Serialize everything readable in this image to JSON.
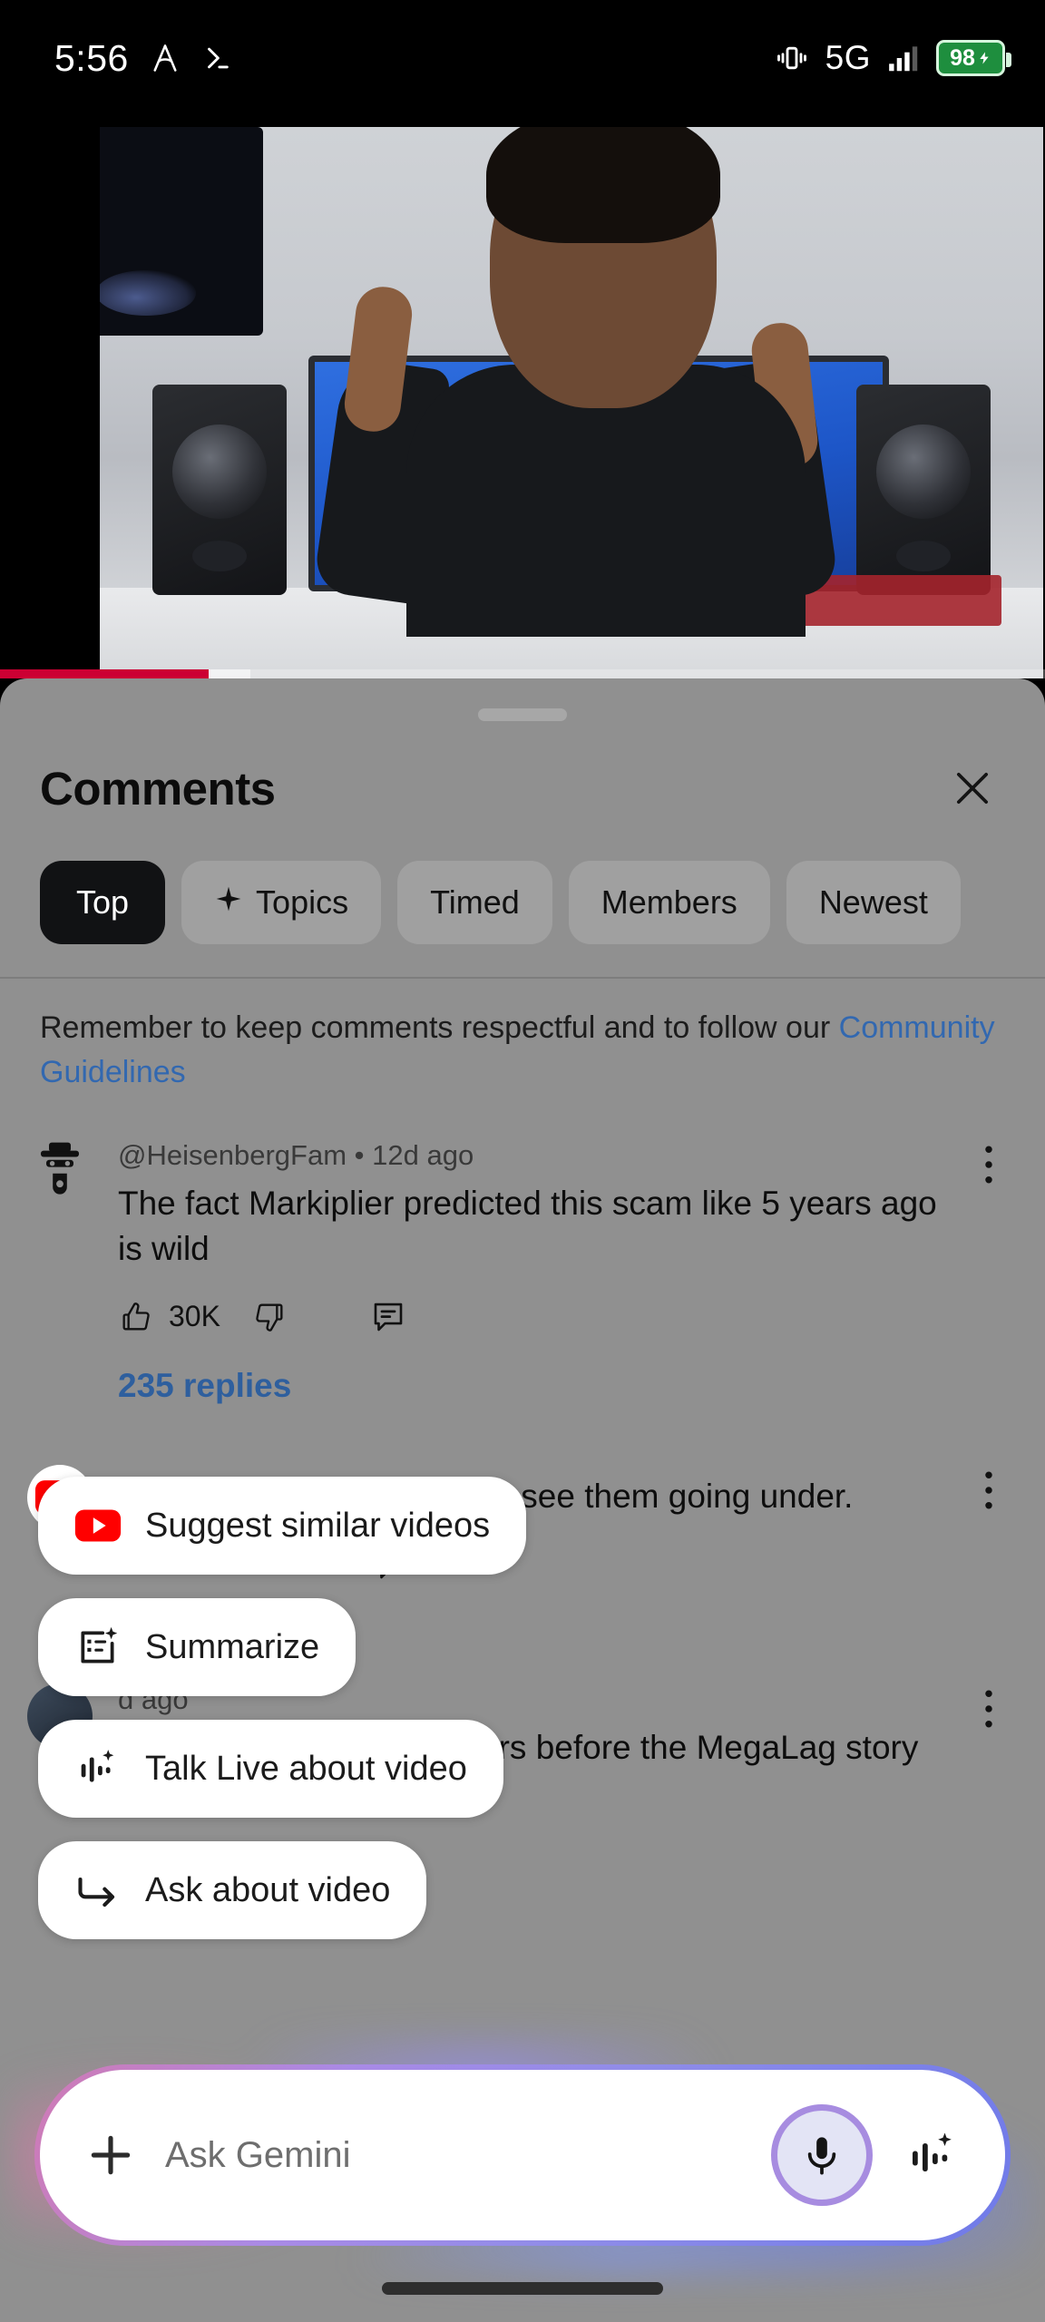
{
  "status_bar": {
    "time": "5:56",
    "left_icons": [
      "assistant-a-icon",
      "terminal-prompt-icon"
    ],
    "network_label": "5G",
    "battery_percent": "98",
    "battery_color": "#1e8e3e",
    "right_icons": [
      "vibrate-icon",
      "signal-bars-icon",
      "battery-charging-icon"
    ]
  },
  "video": {
    "progress_percent": 20,
    "buffer_percent": 24,
    "progress_color": "#cc0033"
  },
  "sheet": {
    "title": "Comments",
    "close_label": "Close",
    "chips": [
      {
        "label": "Top",
        "active": true,
        "icon": null
      },
      {
        "label": "Topics",
        "active": false,
        "icon": "sparkle-icon"
      },
      {
        "label": "Timed",
        "active": false,
        "icon": null
      },
      {
        "label": "Members",
        "active": false,
        "icon": null
      },
      {
        "label": "Newest",
        "active": false,
        "icon": null
      }
    ],
    "guidelines": {
      "text": "Remember to keep comments respectful and to follow our ",
      "link": "Community Guidelines",
      "link_color": "#3268b0"
    },
    "comments": [
      {
        "author": "@HeisenbergFam",
        "separator": "•",
        "time": "12d ago",
        "text": "The fact Markiplier predicted this scam like 5 years ago is wild",
        "likes": "30K",
        "replies": "235 replies",
        "avatar": "heisenberg-hat-avatar"
      },
      {
        "author": "",
        "separator": "",
        "time": "",
        "text": "e a deal, not once. Glad to see them going under.",
        "likes": "",
        "replies": "",
        "avatar": "youtube-logo-avatar"
      },
      {
        "author": "",
        "separator": "",
        "time": "d ago",
        "text": "now: Honey had 20M users before the MegaLag story broke out.",
        "likes": "",
        "replies": "",
        "avatar": "camera-avatar"
      }
    ]
  },
  "suggestions": [
    {
      "label": "Suggest similar videos",
      "icon": "youtube-play-icon"
    },
    {
      "label": "Summarize",
      "icon": "summarize-sparkle-icon"
    },
    {
      "label": "Talk Live about video",
      "icon": "waveform-sparkle-icon"
    },
    {
      "label": "Ask about video",
      "icon": "arrow-turn-right-icon"
    }
  ],
  "gemini_bar": {
    "placeholder": "Ask Gemini",
    "plus_icon": "plus-icon",
    "mic_icon": "microphone-icon",
    "live_icon": "waveform-sparkle-icon",
    "accent_start": "#d07ab4",
    "accent_end": "#6f7ae8"
  },
  "nav": {
    "home_indicator": "home-indicator"
  }
}
